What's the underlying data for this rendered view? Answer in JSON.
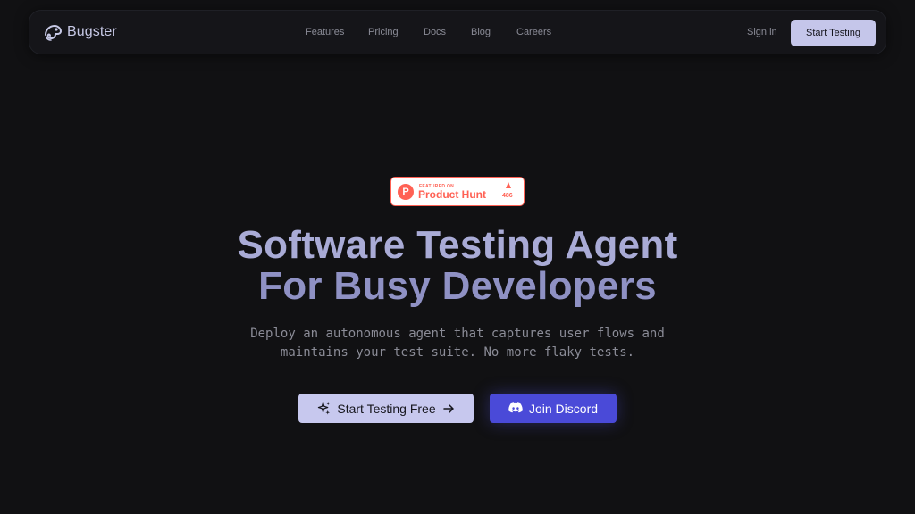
{
  "brand": {
    "name": "Bugster",
    "icon": "chameleon-logo-icon"
  },
  "nav": {
    "links": [
      "Features",
      "Pricing",
      "Docs",
      "Blog",
      "Careers"
    ],
    "signin": "Sign in",
    "cta": "Start Testing"
  },
  "product_hunt": {
    "featured_on": "FEATURED ON",
    "name": "Product Hunt",
    "logo_letter": "P",
    "upvotes": "486",
    "icons": [
      "product-hunt-logo-icon",
      "upvote-triangle-icon"
    ]
  },
  "hero": {
    "title_line1": "Software Testing Agent",
    "title_line2": "For Busy Developers",
    "subtitle_line1": "Deploy an autonomous agent that captures user flows and",
    "subtitle_line2": "maintains your test suite. No more flaky tests."
  },
  "cta": {
    "primary_label": "Start Testing Free",
    "primary_icons": [
      "sparkles-icon",
      "arrow-right-icon"
    ],
    "discord_label": "Join Discord",
    "discord_icon": "discord-icon"
  },
  "colors": {
    "background": "#111113",
    "accent_light": "#c7c8ee",
    "discord": "#4a4ad8",
    "product_hunt": "#ff6154"
  }
}
